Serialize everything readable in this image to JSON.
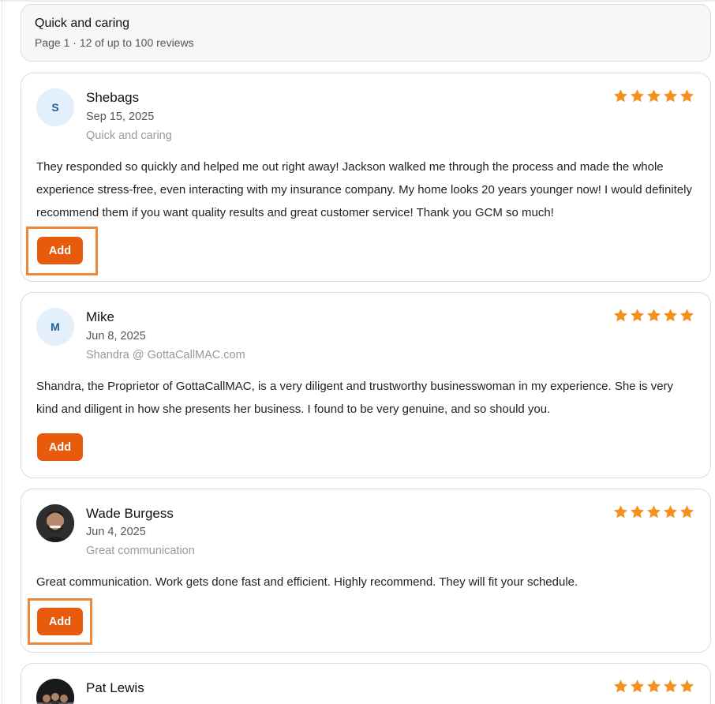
{
  "header": {
    "title": "Quick and caring",
    "subtitle": "Page 1 · 12 of up to 100 reviews"
  },
  "colors": {
    "accent": "#e85a0c",
    "star": "#f5901e",
    "highlight": "#f0883a"
  },
  "reviews": [
    {
      "avatar_initial": "S",
      "name": "Shebags",
      "date": "Sep 15, 2025",
      "subtitle": "Quick and caring",
      "rating": 5,
      "text": "They responded so quickly and helped me out right away! Jackson walked me through the process and made the whole experience stress-free, even interacting with my insurance company. My home looks 20 years younger now! I would definitely recommend them if you want quality results and great customer service! Thank you GCM so much!",
      "button_label": "Add"
    },
    {
      "avatar_initial": "M",
      "name": "Mike",
      "date": "Jun 8, 2025",
      "subtitle": "Shandra @ GottaCallMAC.com",
      "rating": 5,
      "text": "Shandra, the Proprietor of GottaCallMAC, is a very diligent and trustworthy businesswoman in my experience. She is very kind and diligent in how she presents her business. I found to be very genuine, and so should you.",
      "button_label": "Add"
    },
    {
      "name": "Wade Burgess",
      "date": "Jun 4, 2025",
      "subtitle": "Great communication",
      "rating": 5,
      "text": "Great communication. Work gets done fast and efficient. Highly recommend. They will fit your schedule.",
      "button_label": "Add"
    },
    {
      "name": "Pat Lewis",
      "rating": 5
    }
  ]
}
